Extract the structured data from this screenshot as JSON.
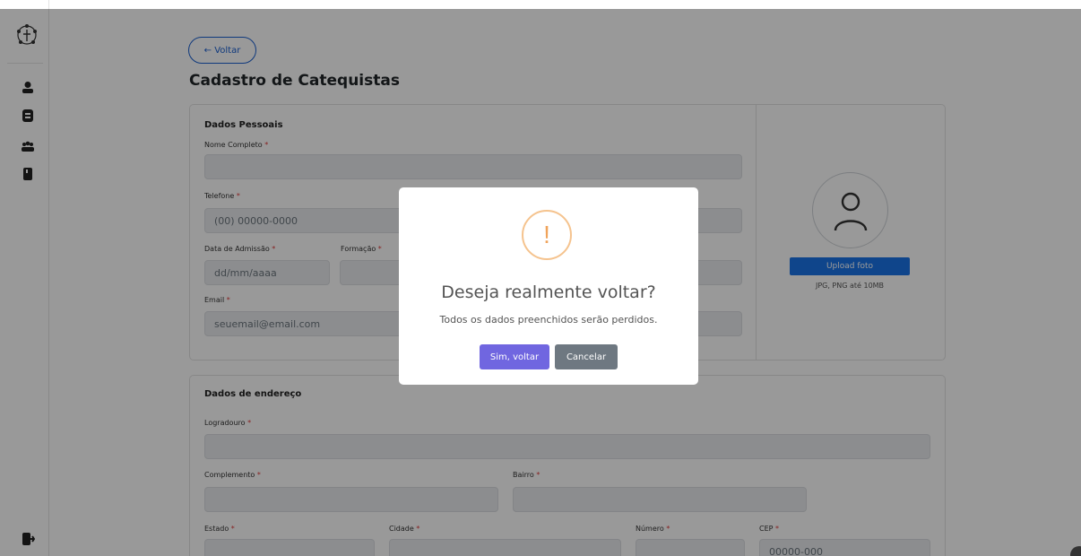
{
  "app": {
    "back_label": "← Voltar",
    "page_title": "Cadastro de Catequistas"
  },
  "sidebar": {
    "logo_icon": "logo-icon",
    "items": [
      {
        "icon": "user-icon"
      },
      {
        "icon": "badge-icon"
      },
      {
        "icon": "group-icon"
      },
      {
        "icon": "book-icon"
      }
    ],
    "logout_icon": "logout-icon"
  },
  "personal": {
    "section_title": "Dados Pessoais",
    "name_label": "Nome Completo",
    "name_value": "",
    "phone_label": "Telefone",
    "phone_placeholder": "(00) 00000-0000",
    "admission_label": "Data de Admissão",
    "admission_placeholder": "dd/mm/aaaa",
    "formation_label": "Formação",
    "email_label": "Email",
    "email_placeholder": "seuemail@email.com",
    "required_mark": "*"
  },
  "photo": {
    "upload_label": "Upload foto",
    "hint": "JPG, PNG até 10MB"
  },
  "address": {
    "section_title": "Dados de endereço",
    "street_label": "Logradouro",
    "complement_label": "Complemento",
    "district_label": "Bairro",
    "state_label": "Estado",
    "city_label": "Cidade",
    "number_label": "Número",
    "cep_label": "CEP",
    "cep_placeholder": "00000-000"
  },
  "modal": {
    "icon_glyph": "!",
    "title": "Deseja realmente voltar?",
    "text": "Todos os dados preenchidos serão perdidos.",
    "confirm_label": "Sim, voltar",
    "cancel_label": "Cancelar"
  },
  "colors": {
    "primary": "#1a73e8",
    "confirm": "#7066e0",
    "cancel": "#6e7881",
    "warning": "#f0a35a"
  }
}
